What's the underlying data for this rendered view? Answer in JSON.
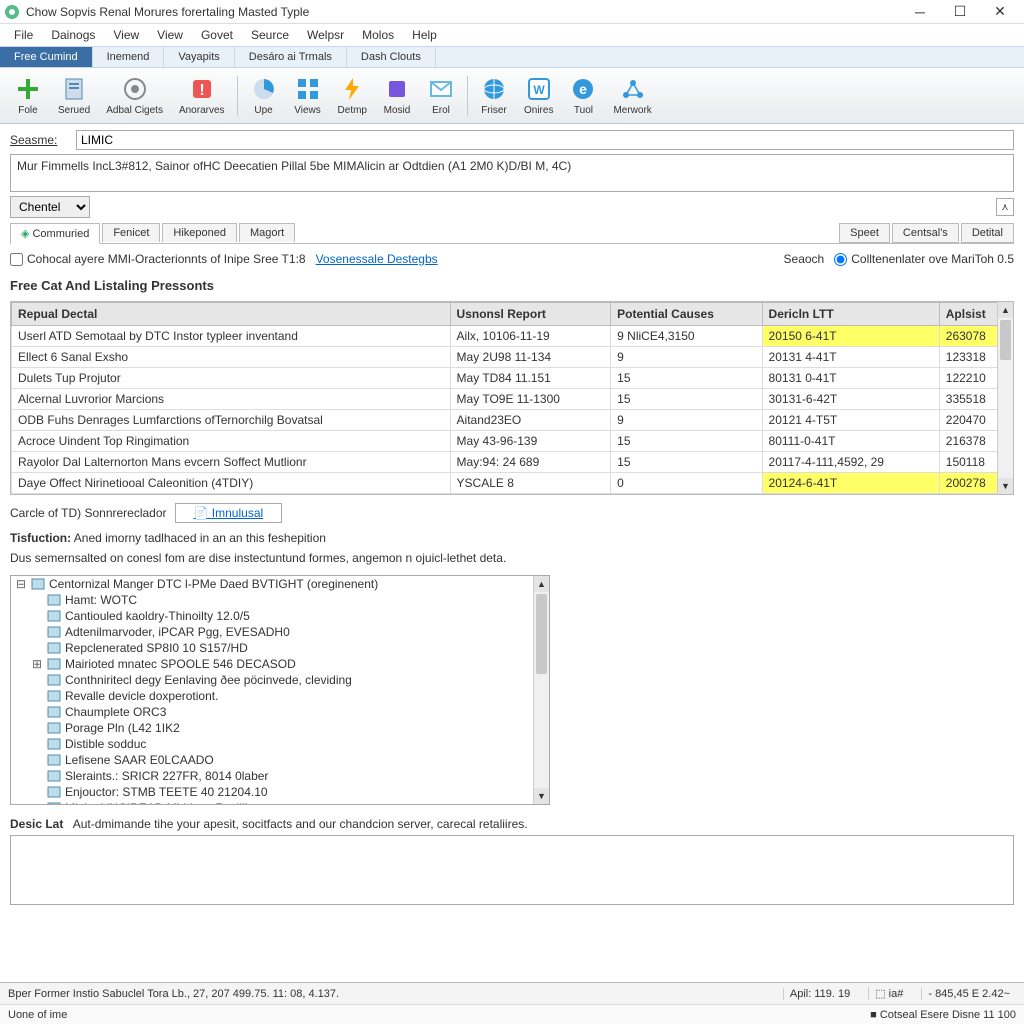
{
  "window": {
    "title": "Chow Sopvis Renal Morures forertaling Masted Typle"
  },
  "menubar": [
    "File",
    "Dainogs",
    "View",
    "View",
    "Govet",
    "Seurce",
    "Welpsr",
    "Molos",
    "Help"
  ],
  "submenubar": [
    {
      "label": "Free Cumind",
      "active": true
    },
    {
      "label": "Inemend",
      "active": false
    },
    {
      "label": "Vayapits",
      "active": false
    },
    {
      "label": "Desáro ai Trmals",
      "active": false
    },
    {
      "label": "Dash Clouts",
      "active": false
    }
  ],
  "toolbar": [
    {
      "label": "Fole",
      "icon": "plus",
      "color": "#3a3"
    },
    {
      "label": "Serued",
      "icon": "doc",
      "color": "#4af"
    },
    {
      "label": "Adbal Cigets",
      "icon": "target",
      "color": "#888"
    },
    {
      "label": "Anorarves",
      "icon": "warn",
      "color": "#e55"
    },
    {
      "sep": true
    },
    {
      "label": "Upe",
      "icon": "pie",
      "color": "#39d"
    },
    {
      "label": "Views",
      "icon": "grid",
      "color": "#39d"
    },
    {
      "label": "Detmp",
      "icon": "bolt",
      "color": "#fa0"
    },
    {
      "label": "Mosid",
      "icon": "box",
      "color": "#75d"
    },
    {
      "label": "Erol",
      "icon": "mail",
      "color": "#6bd"
    },
    {
      "sep": true
    },
    {
      "label": "Friser",
      "icon": "globe",
      "color": "#39d"
    },
    {
      "label": "Onires",
      "icon": "ow",
      "color": "#39d"
    },
    {
      "label": "Tuol",
      "icon": "e",
      "color": "#39d"
    },
    {
      "label": "Merwork",
      "icon": "net",
      "color": "#39d"
    }
  ],
  "form": {
    "seasme_label": "Seasme:",
    "seasme_value": "LIMIC",
    "desc_value": "Mur Fimmells IncL3#812, Sainor ofHC Deecatien Pillal 5be MIMAlicin ar Odtdien (A1 2M0 K)D/BI M, 4C)",
    "dropdown_value": "Chentel"
  },
  "tabs": {
    "left": [
      {
        "label": "Commuried",
        "icon": true
      },
      {
        "label": "Fenicet"
      },
      {
        "label": "Hikeponed"
      },
      {
        "label": "Magort"
      }
    ],
    "right": [
      "Speet",
      "Centsal's",
      "Detital"
    ]
  },
  "searchrow": {
    "checkbox_label": "Cohocal ayere MMI-Oracterionnts of Inipe Sree T1:8",
    "link": "Vosenessale Destegbs",
    "search_label": "Seaoch",
    "radio_label": "Colltenenlater ove MariToh 0.5"
  },
  "section_title": "Free Cat And Listaling Pressonts",
  "table": {
    "headers": [
      "Repual Dectal",
      "Usnonsl Report",
      "Potential Causes",
      "Dericln LTT",
      "Aplsist"
    ],
    "rows": [
      {
        "c": [
          "Userl ATD Semotaal by DTC Instor typleer inventand",
          "Ailx, 10106-11-19",
          "9 NliCE4,3150",
          "20150 6-41T",
          "263078"
        ],
        "hl": [
          3,
          4
        ]
      },
      {
        "c": [
          "Ellect 6 Sanal Exsho",
          "May 2U98 11-134",
          "9",
          "20131 4-41T",
          "123318"
        ]
      },
      {
        "c": [
          "Dulets Tup Projutor",
          "May TD84 11.151",
          "15",
          "80131 0-41T",
          "122210"
        ]
      },
      {
        "c": [
          "Alcernal Luvrorior Marcions",
          "May TO9E 11-1300",
          "15",
          "30131-6-42T",
          "335518"
        ]
      },
      {
        "c": [
          "ODB Fuhs Denrages Lumfarctions ofTernorchilg Bovatsal",
          "Aitand23EO",
          "9",
          "20121 4-T5T",
          "220470"
        ]
      },
      {
        "c": [
          "Acroce Uindent Top Ringimation",
          "May 43-96-139",
          "15",
          "80111-0-41T",
          "216378"
        ]
      },
      {
        "c": [
          "Rayolor Dal Lalternorton Mans evcern Soffect Mutlionr",
          "May:94: 24 689",
          "15",
          "20117-4-111,4592, 29",
          "150118"
        ]
      },
      {
        "c": [
          "Daye Offect Nirinetiooal Caleonition (4TDIY)",
          "YSCALE 8",
          "0",
          "20124-6-41T",
          "200278"
        ],
        "hl": [
          3,
          4
        ]
      }
    ]
  },
  "circle": {
    "label": "Carcle of TD) Sonnrereclador",
    "link": "Imnulusal"
  },
  "instruction": {
    "title": "Tisfuction:",
    "title_text": "Aned imorny tadlhaced in an an this feshepition",
    "body": "Dus semernsalted on conesl fom are dise instectuntund formes, angemon n ojuicl-lethet deta."
  },
  "tree": [
    {
      "exp": "−",
      "label": "Centornizal Manger DTC l-PMe Daed BVTIGHT (oreginenent)"
    },
    {
      "exp": "",
      "label": "Hamt: WOTC"
    },
    {
      "exp": "",
      "label": "Cantiouled kaoldry-Thinoilty 12.0/5"
    },
    {
      "exp": "",
      "label": "Adtenilmarvoder, iPCAR Pgg, EVESADH0"
    },
    {
      "exp": "",
      "label": "Repclenerated SP8I0 10 S157/HD"
    },
    {
      "exp": "+",
      "label": "Mairioted mnatec SPOOLE 546 DECASOD"
    },
    {
      "exp": "",
      "label": "Conthniritecl degy Eenlaving ðee pöcinvede, cleviding"
    },
    {
      "exp": "",
      "label": "Revalle devicle doxperotiont."
    },
    {
      "exp": "",
      "label": "Chaumplete ORC3"
    },
    {
      "exp": "",
      "label": "Porage Pln (L42 1IK2"
    },
    {
      "exp": "",
      "label": "Distible sodduc"
    },
    {
      "exp": "",
      "label": "Lefisene SAAR E0LCAADO"
    },
    {
      "exp": "",
      "label": "Sleraints.: SRICR 227FR, 8014 0laber"
    },
    {
      "exp": "",
      "label": "Enjouctor: STMB TEETE 40 21204.10"
    },
    {
      "exp": "",
      "label": "Minite L'NCIREAD Mirhions Rusillion"
    }
  ],
  "desc_section": {
    "title": "Desic Lat",
    "text": "Aut-dmimande tihe your apesit, socitfacts and our chandcion server, carecal retaliires."
  },
  "status1": {
    "left": "Bper Former Instio Sabuclel Tora Lb., 27, 207 499.75. 11: 08, 4.137.",
    "mid": "Apil: 119. 19",
    "right1": "⬚ ia#",
    "right2": "- 845,45 E 2.42~"
  },
  "status2": {
    "left": "Uone of ime",
    "right": "■ Cotseal Esere Disne 11  100"
  }
}
